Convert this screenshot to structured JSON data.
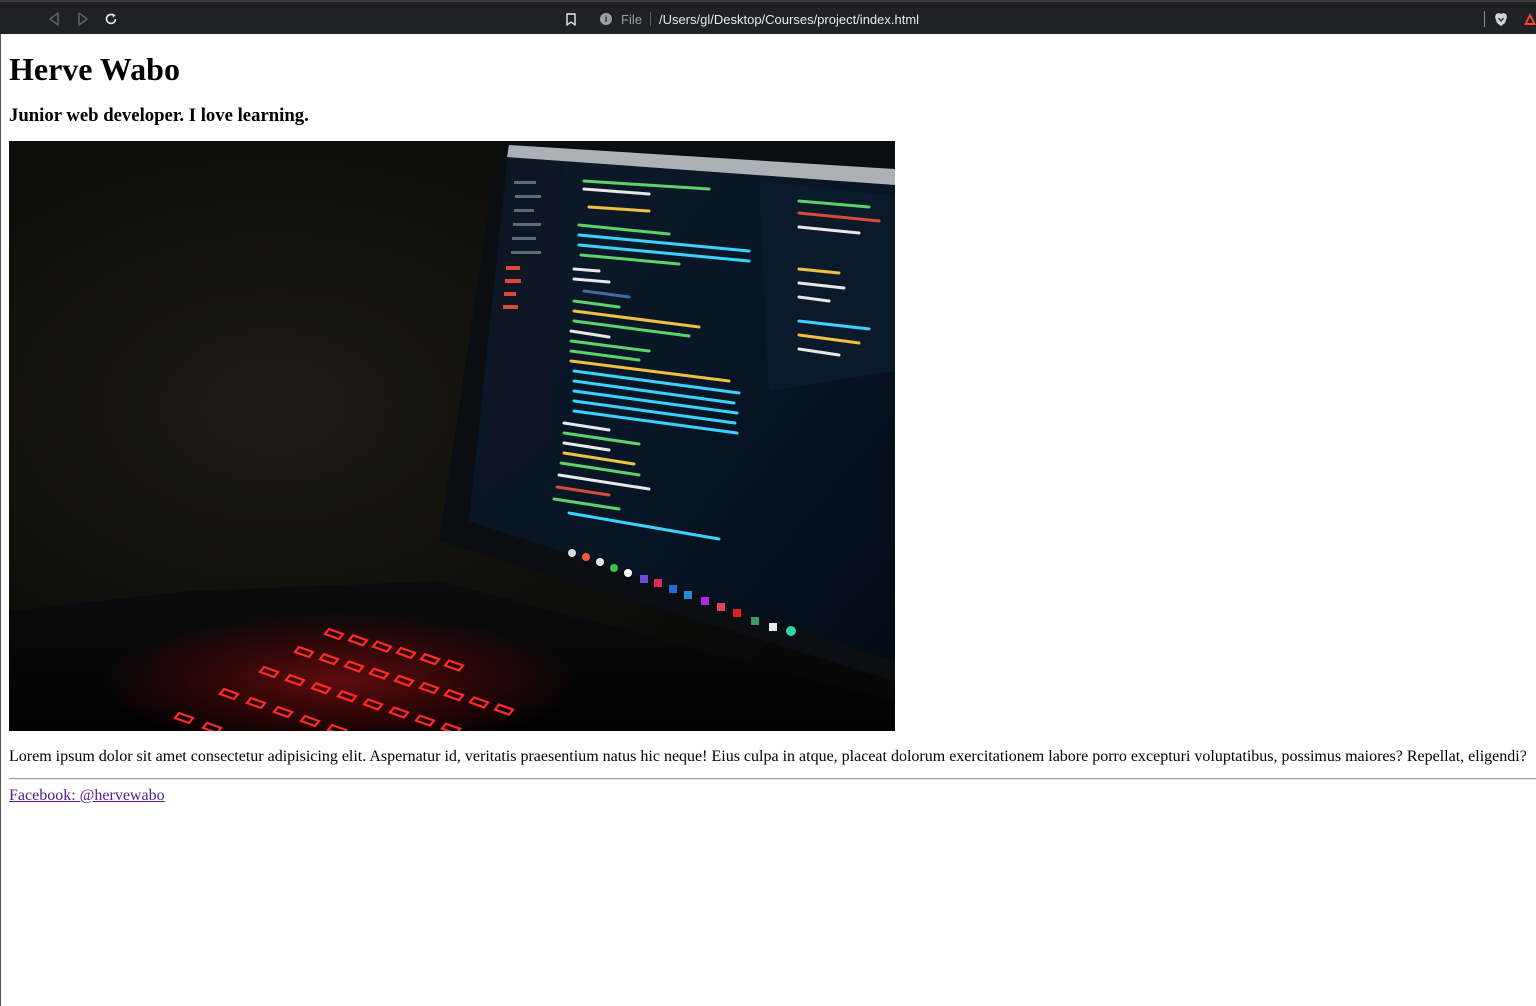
{
  "browser": {
    "address_scheme": "File",
    "address_url": "/Users/gl/Desktop/Courses/project/index.html"
  },
  "page": {
    "title": "Herve Wabo",
    "subtitle": "Junior web developer. I love learning.",
    "paragraph": "Lorem ipsum dolor sit amet consectetur adipisicing elit. Aspernatur id, veritatis praesentium natus hic neque! Eius culpa in atque, placeat dolorum exercitationem labore porro excepturi voluptatibus, possimus maiores? Repellat, eligendi?",
    "link_text": "Facebook: @hervewabo"
  },
  "colors": {
    "toolbar_bg": "#202124",
    "visited_link": "#551a8b",
    "keyboard_glow": "#ff2a2a",
    "code_green": "#5bd36a",
    "code_cyan": "#3ad3ff"
  },
  "icons": {
    "back": "back-arrow-icon",
    "forward": "forward-arrow-icon",
    "reload": "reload-icon",
    "bookmark": "bookmark-icon",
    "info": "info-icon",
    "brave": "brave-shield-icon",
    "rewards": "brave-rewards-icon"
  }
}
